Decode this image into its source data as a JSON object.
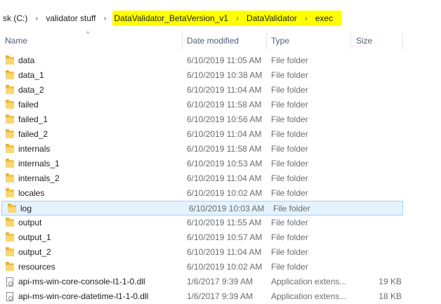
{
  "breadcrumb": {
    "items": [
      "sk (C:)",
      "validator stuff",
      "DataValidator_BetaVersion_v1",
      "DataValidator",
      "exec"
    ],
    "separator": "›"
  },
  "columns": {
    "name": "Name",
    "date": "Date modified",
    "type": "Type",
    "size": "Size"
  },
  "files": [
    {
      "name": "data",
      "date": "6/10/2019 11:05 AM",
      "type": "File folder",
      "size": "",
      "icon": "folder-icon"
    },
    {
      "name": "data_1",
      "date": "6/10/2019 10:38 AM",
      "type": "File folder",
      "size": "",
      "icon": "folder-icon"
    },
    {
      "name": "data_2",
      "date": "6/10/2019 11:04 AM",
      "type": "File folder",
      "size": "",
      "icon": "folder-icon"
    },
    {
      "name": "failed",
      "date": "6/10/2019 11:58 AM",
      "type": "File folder",
      "size": "",
      "icon": "folder-icon"
    },
    {
      "name": "failed_1",
      "date": "6/10/2019 10:56 AM",
      "type": "File folder",
      "size": "",
      "icon": "folder-icon"
    },
    {
      "name": "failed_2",
      "date": "6/10/2019 11:04 AM",
      "type": "File folder",
      "size": "",
      "icon": "folder-icon"
    },
    {
      "name": "internals",
      "date": "6/10/2019 11:58 AM",
      "type": "File folder",
      "size": "",
      "icon": "folder-icon"
    },
    {
      "name": "internals_1",
      "date": "6/10/2019 10:53 AM",
      "type": "File folder",
      "size": "",
      "icon": "folder-icon"
    },
    {
      "name": "internals_2",
      "date": "6/10/2019 11:04 AM",
      "type": "File folder",
      "size": "",
      "icon": "folder-icon"
    },
    {
      "name": "locales",
      "date": "6/10/2019 10:02 AM",
      "type": "File folder",
      "size": "",
      "icon": "folder-icon"
    },
    {
      "name": "log",
      "date": "6/10/2019 10:03 AM",
      "type": "File folder",
      "size": "",
      "icon": "folder-icon",
      "selected": true
    },
    {
      "name": "output",
      "date": "6/10/2019 11:55 AM",
      "type": "File folder",
      "size": "",
      "icon": "folder-icon"
    },
    {
      "name": "output_1",
      "date": "6/10/2019 10:57 AM",
      "type": "File folder",
      "size": "",
      "icon": "folder-icon"
    },
    {
      "name": "output_2",
      "date": "6/10/2019 11:04 AM",
      "type": "File folder",
      "size": "",
      "icon": "folder-icon"
    },
    {
      "name": "resources",
      "date": "6/10/2019 10:02 AM",
      "type": "File folder",
      "size": "",
      "icon": "folder-icon"
    },
    {
      "name": "api-ms-win-core-console-l1-1-0.dll",
      "date": "1/6/2017 9:39 AM",
      "type": "Application extens...",
      "size": "19 KB",
      "icon": "dll-file-icon"
    },
    {
      "name": "api-ms-win-core-datetime-l1-1-0.dll",
      "date": "1/6/2017 9:39 AM",
      "type": "Application extens...",
      "size": "18 KB",
      "icon": "dll-file-icon"
    }
  ],
  "colors": {
    "highlight": "#ffff00",
    "selection_bg": "#e5f3ff",
    "selection_border": "#99d1ff",
    "header_text": "#4c607a"
  }
}
